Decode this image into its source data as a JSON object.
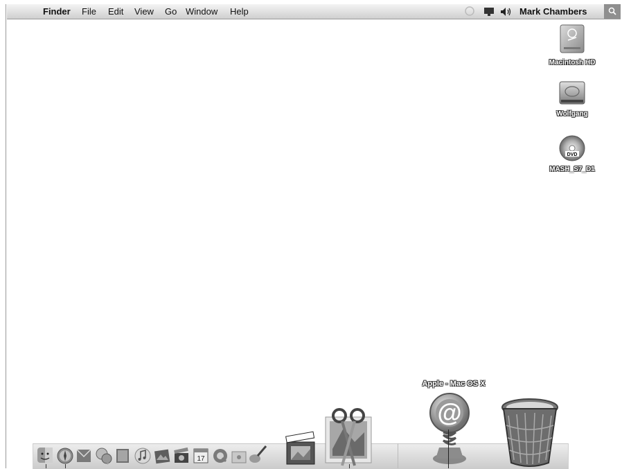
{
  "menubar": {
    "app_name": "Finder",
    "items": [
      "File",
      "Edit",
      "View",
      "Go",
      "Window",
      "Help"
    ],
    "user_name": "Mark Chambers"
  },
  "desktop": {
    "icons": [
      {
        "label": "Macintosh HD",
        "icon": "hard-disk-icon"
      },
      {
        "label": "Wolfgang",
        "icon": "hard-disk-icon"
      },
      {
        "label": "MASH_S7_D1",
        "icon": "dvd-icon"
      }
    ]
  },
  "dock": {
    "tooltip": "Apple - Mac OS X",
    "apps": [
      "finder-icon",
      "safari-icon",
      "mail-icon",
      "ichat-icon",
      "address-book-icon",
      "itunes-icon",
      "iphoto-icon",
      "imovie-icon",
      "ical-icon",
      "quicktime-icon",
      "iweb-icon",
      "garageband-icon",
      "imovie-hd-icon",
      "iwork-scissors-icon"
    ],
    "right": [
      "internet-location-icon",
      "trash-icon"
    ],
    "ical_date": "17"
  }
}
